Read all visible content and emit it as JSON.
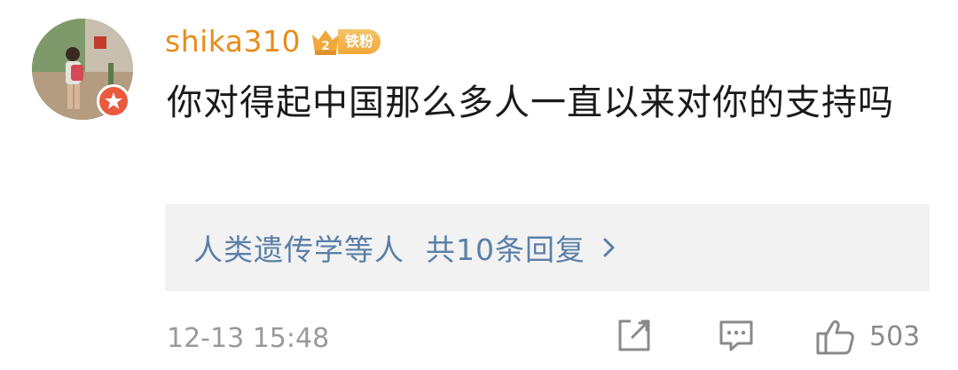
{
  "comment": {
    "username": "shika310",
    "fan_badge": "铁粉",
    "text": "你对得起中国那么多人一直以来对你的支持吗",
    "replies": {
      "users": "人类遗传学等人",
      "count_text": "共10条回复"
    },
    "timestamp": "12-13 15:48",
    "likes": "503"
  },
  "colors": {
    "username": "#e88c19",
    "reply_link": "#5a7fa8",
    "badge": "#f0a93a",
    "verified": "#ea5a3d"
  }
}
